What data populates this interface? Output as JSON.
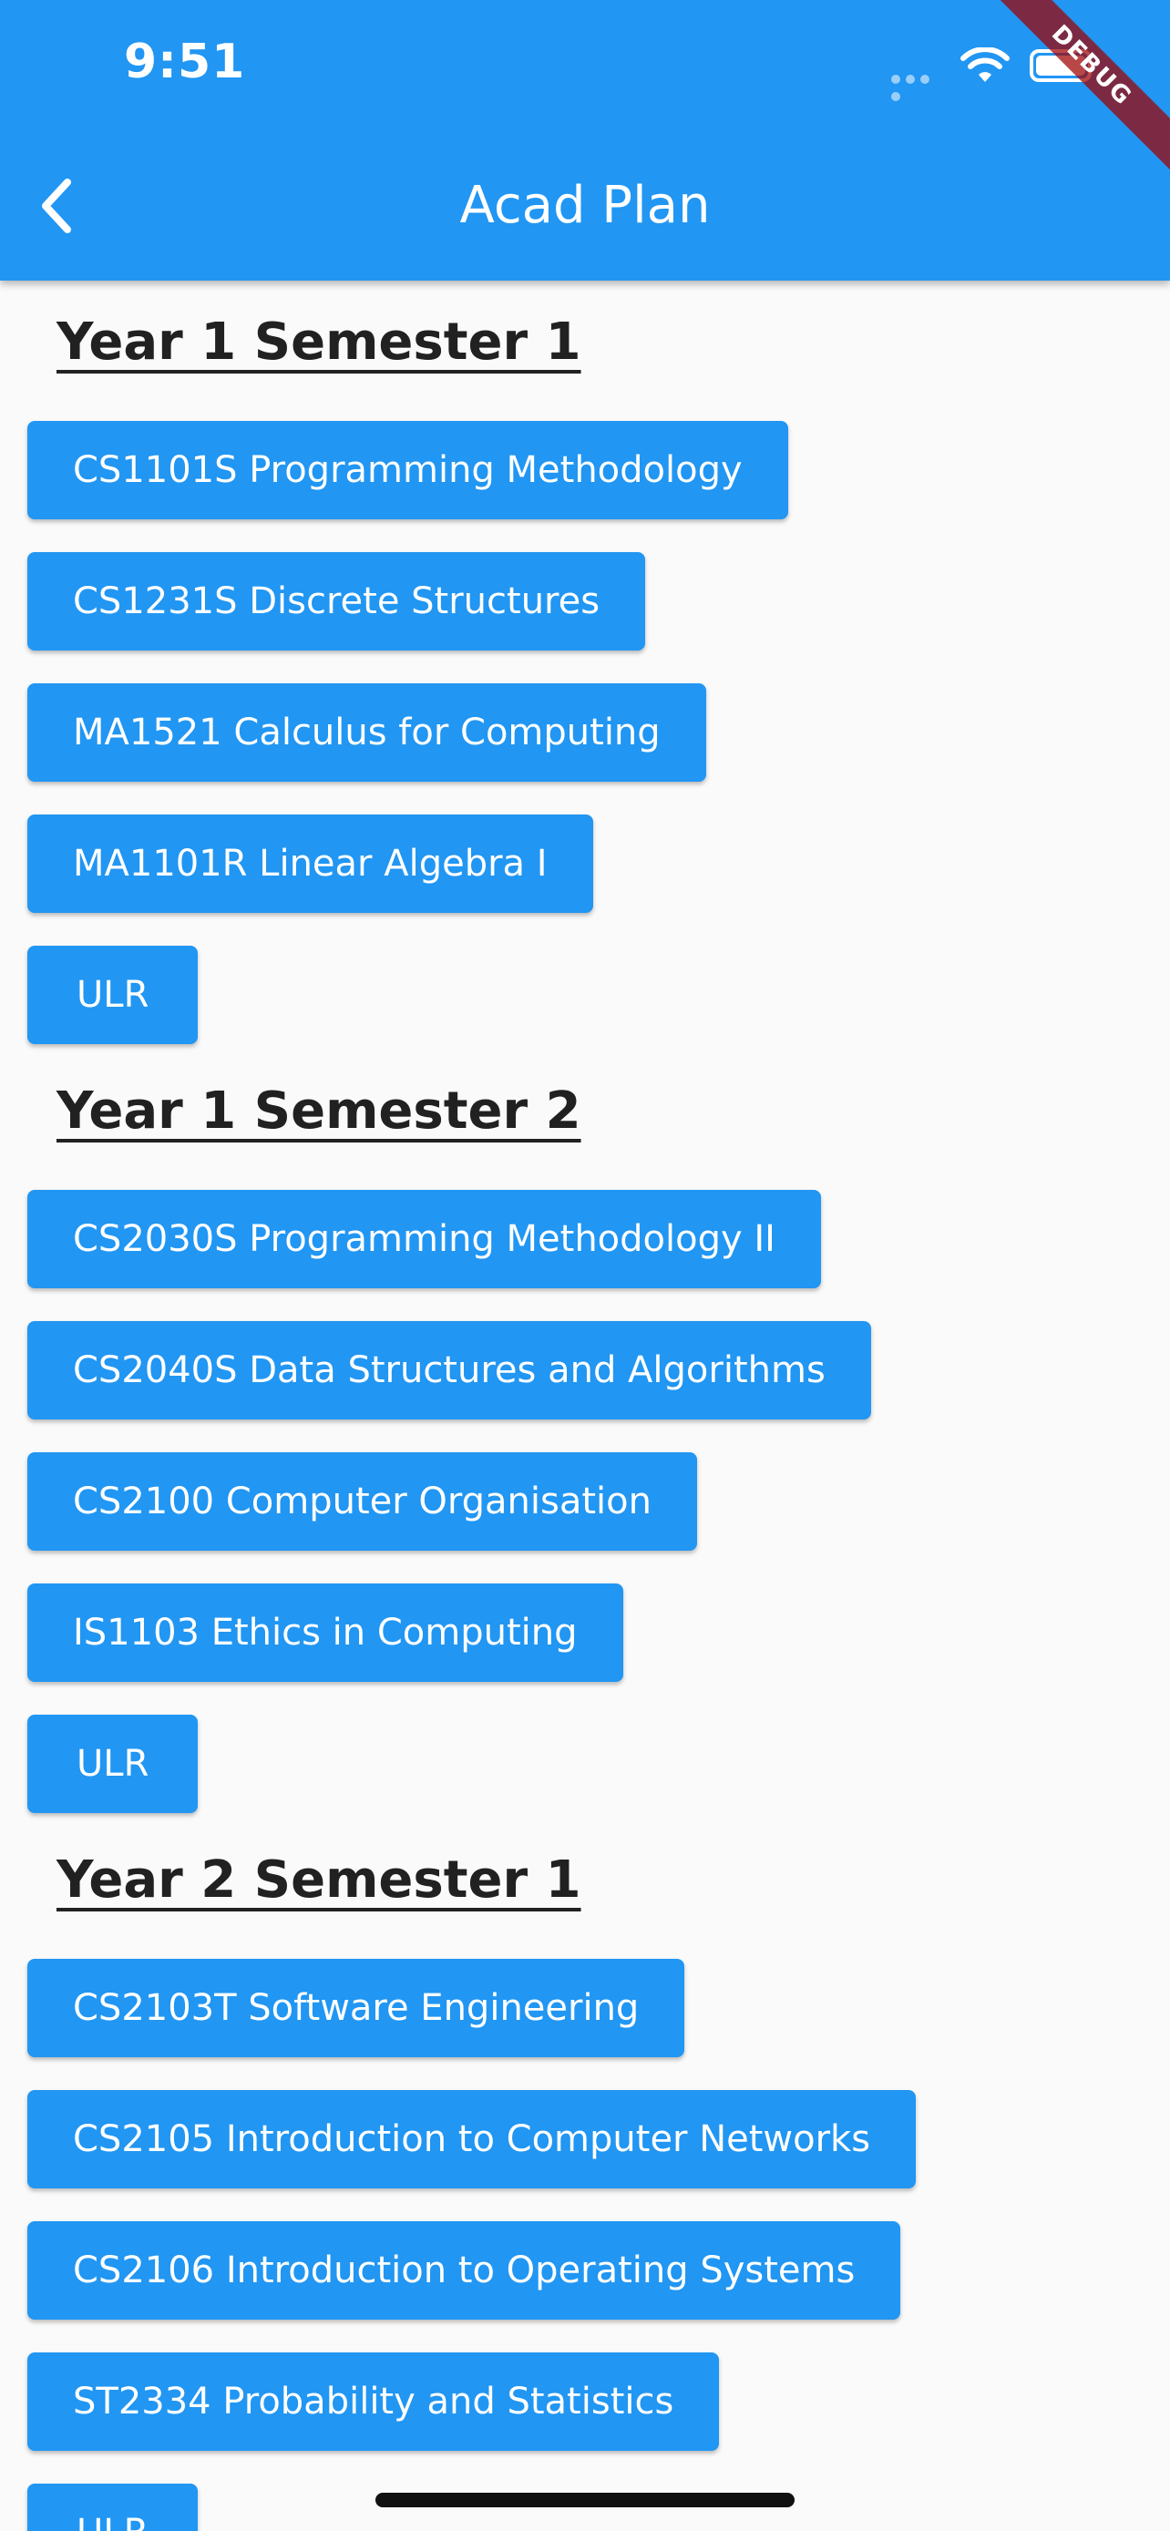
{
  "status_bar": {
    "time": "9:51"
  },
  "app_bar": {
    "title": "Acad Plan",
    "back_icon": "chevron-left-icon"
  },
  "debug_banner": {
    "label": "DEBUG"
  },
  "sections": [
    {
      "heading": "Year 1 Semester 1",
      "modules": [
        "CS1101S Programming Methodology",
        "CS1231S Discrete Structures",
        "MA1521 Calculus for Computing",
        "MA1101R Linear Algebra I",
        "ULR"
      ]
    },
    {
      "heading": "Year 1 Semester 2",
      "modules": [
        "CS2030S Programming Methodology II",
        "CS2040S Data Structures and Algorithms",
        "CS2100 Computer Organisation",
        "IS1103 Ethics in Computing",
        "ULR"
      ]
    },
    {
      "heading": "Year 2 Semester 1",
      "modules": [
        "CS2103T Software Engineering",
        "CS2105 Introduction to Computer Networks",
        "CS2106 Introduction to Operating Systems",
        "ST2334 Probability and Statistics",
        "ULR"
      ]
    }
  ],
  "colors": {
    "primary": "#2196F3",
    "background": "#FAFAFA",
    "heading_text": "#212121",
    "button_text": "#FFFFFF"
  }
}
